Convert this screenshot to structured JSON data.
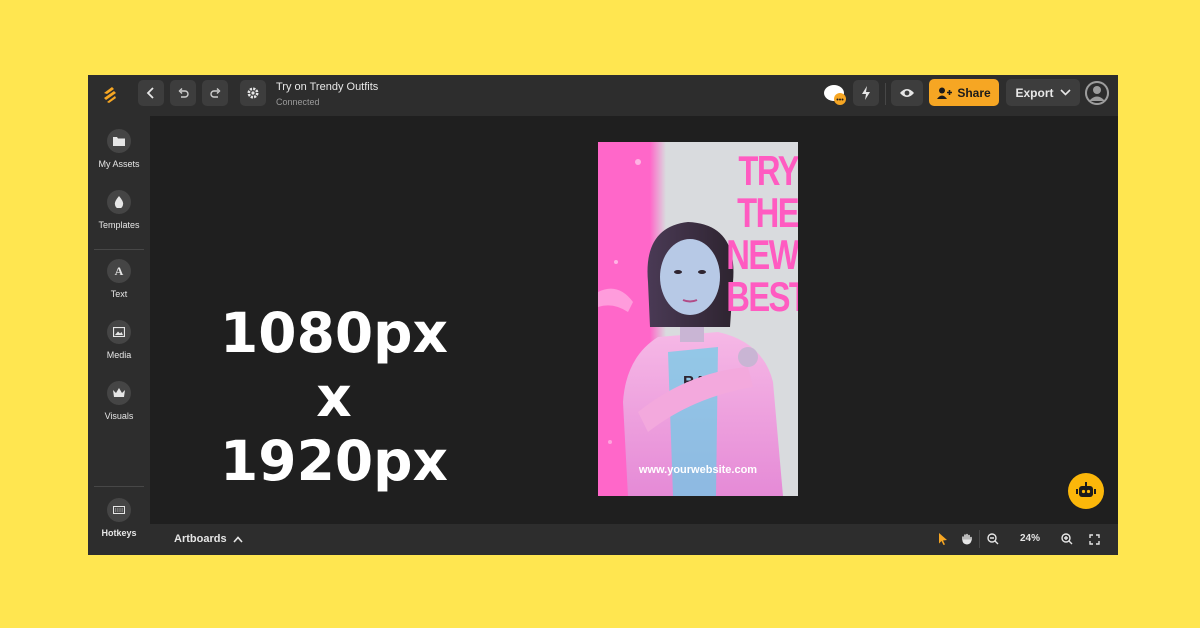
{
  "toolbar": {
    "back_icon": "chevron-left-icon",
    "undo_icon": "undo-icon",
    "redo_icon": "redo-icon",
    "settings_icon": "gear-icon",
    "document_title": "Try on Trendy Outfits",
    "status": "Connected",
    "comments_icon": "comments-icon",
    "lightning_icon": "lightning-icon",
    "preview_icon": "eye-icon",
    "share_label": "Share",
    "export_label": "Export",
    "accent_color": "#f6a623"
  },
  "sidebar": {
    "items": [
      {
        "label": "My Assets",
        "icon": "folder-icon"
      },
      {
        "label": "Templates",
        "icon": "drop-icon"
      },
      {
        "label": "Text",
        "icon": "text-icon"
      },
      {
        "label": "Media",
        "icon": "image-icon"
      },
      {
        "label": "Visuals",
        "icon": "crown-icon"
      }
    ],
    "hotkeys_label": "Hotkeys"
  },
  "canvas": {
    "dimension_lines": [
      "1080px",
      "x",
      "1920px"
    ],
    "artboard": {
      "title_lines": [
        "TRY",
        "THE",
        "NEW",
        "BEST"
      ],
      "url": "www.yourwebsite.com",
      "title_color": "#ff5bc1"
    }
  },
  "bottombar": {
    "artboards_label": "Artboards",
    "zoom_level": "24%"
  }
}
